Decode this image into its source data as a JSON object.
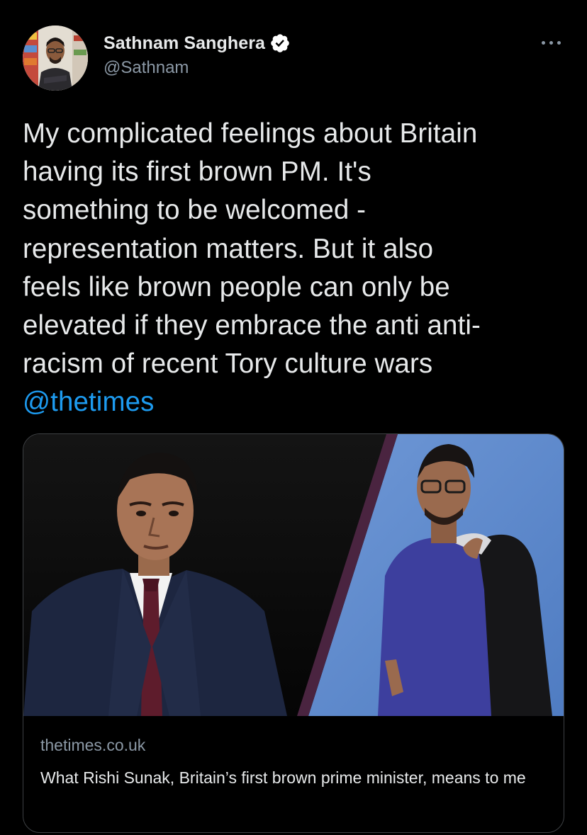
{
  "author": {
    "display_name": "Sathnam Sanghera",
    "handle": "@Sathnam",
    "verified": true,
    "avatar_icon": "profile-photo"
  },
  "tweet": {
    "text": "My complicated feelings about Britain\nhaving its first brown PM. It's\nsomething to be welcomed -\nrepresentation matters. But it also\nfeels like brown people can only be\nelevated if they embrace the anti anti-\nracism of recent Tory culture wars\n",
    "mention": "@thetimes"
  },
  "link_card": {
    "domain": "thetimes.co.uk",
    "title": "What Rishi Sunak, Britain’s first brown prime minister, means to me"
  },
  "colors": {
    "background": "#000000",
    "text": "#e7e9ea",
    "secondary_text": "#8b98a5",
    "link": "#1d9bf0",
    "border": "#3e4144",
    "verified_badge": "#ffffff"
  },
  "icons": {
    "more": "more-horizontal-icon",
    "verified": "verified-badge-icon"
  }
}
